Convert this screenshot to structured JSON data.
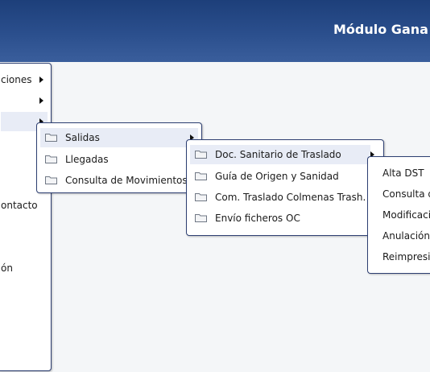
{
  "header": {
    "title": "Módulo Gana"
  },
  "menu_l1": {
    "items": [
      {
        "label": "ciones",
        "has_submenu": true
      },
      {
        "label": "",
        "has_submenu": true
      },
      {
        "label": "",
        "has_submenu": true
      },
      {
        "label": "ontacto",
        "has_submenu": false
      },
      {
        "label": "ón",
        "has_submenu": false
      }
    ]
  },
  "menu_l2": {
    "items": [
      {
        "label": "Salidas",
        "icon": "folder-icon",
        "has_submenu": true
      },
      {
        "label": "Llegadas",
        "icon": "folder-icon",
        "has_submenu": false
      },
      {
        "label": "Consulta de Movimientos",
        "icon": "folder-icon",
        "has_submenu": false
      }
    ]
  },
  "menu_l3": {
    "items": [
      {
        "label": "Doc. Sanitario de Traslado",
        "icon": "folder-icon",
        "has_submenu": true
      },
      {
        "label": "Guía de Origen y Sanidad",
        "icon": "folder-icon",
        "has_submenu": false
      },
      {
        "label": "Com. Traslado Colmenas Trash.",
        "icon": "folder-icon",
        "has_submenu": false
      },
      {
        "label": "Envío ficheros OC",
        "icon": "folder-icon",
        "has_submenu": false
      }
    ]
  },
  "menu_l4": {
    "items": [
      {
        "label": "Alta DST"
      },
      {
        "label": "Consulta d"
      },
      {
        "label": "Modificaci"
      },
      {
        "label": "Anulación"
      },
      {
        "label": "Reimpresi"
      }
    ]
  },
  "colors": {
    "header_top": "#1d3f7a",
    "header_bottom": "#3a5e9c",
    "menu_border": "#2d3f72",
    "active_item": "#e8ecf6",
    "background": "#f4f6f8"
  }
}
